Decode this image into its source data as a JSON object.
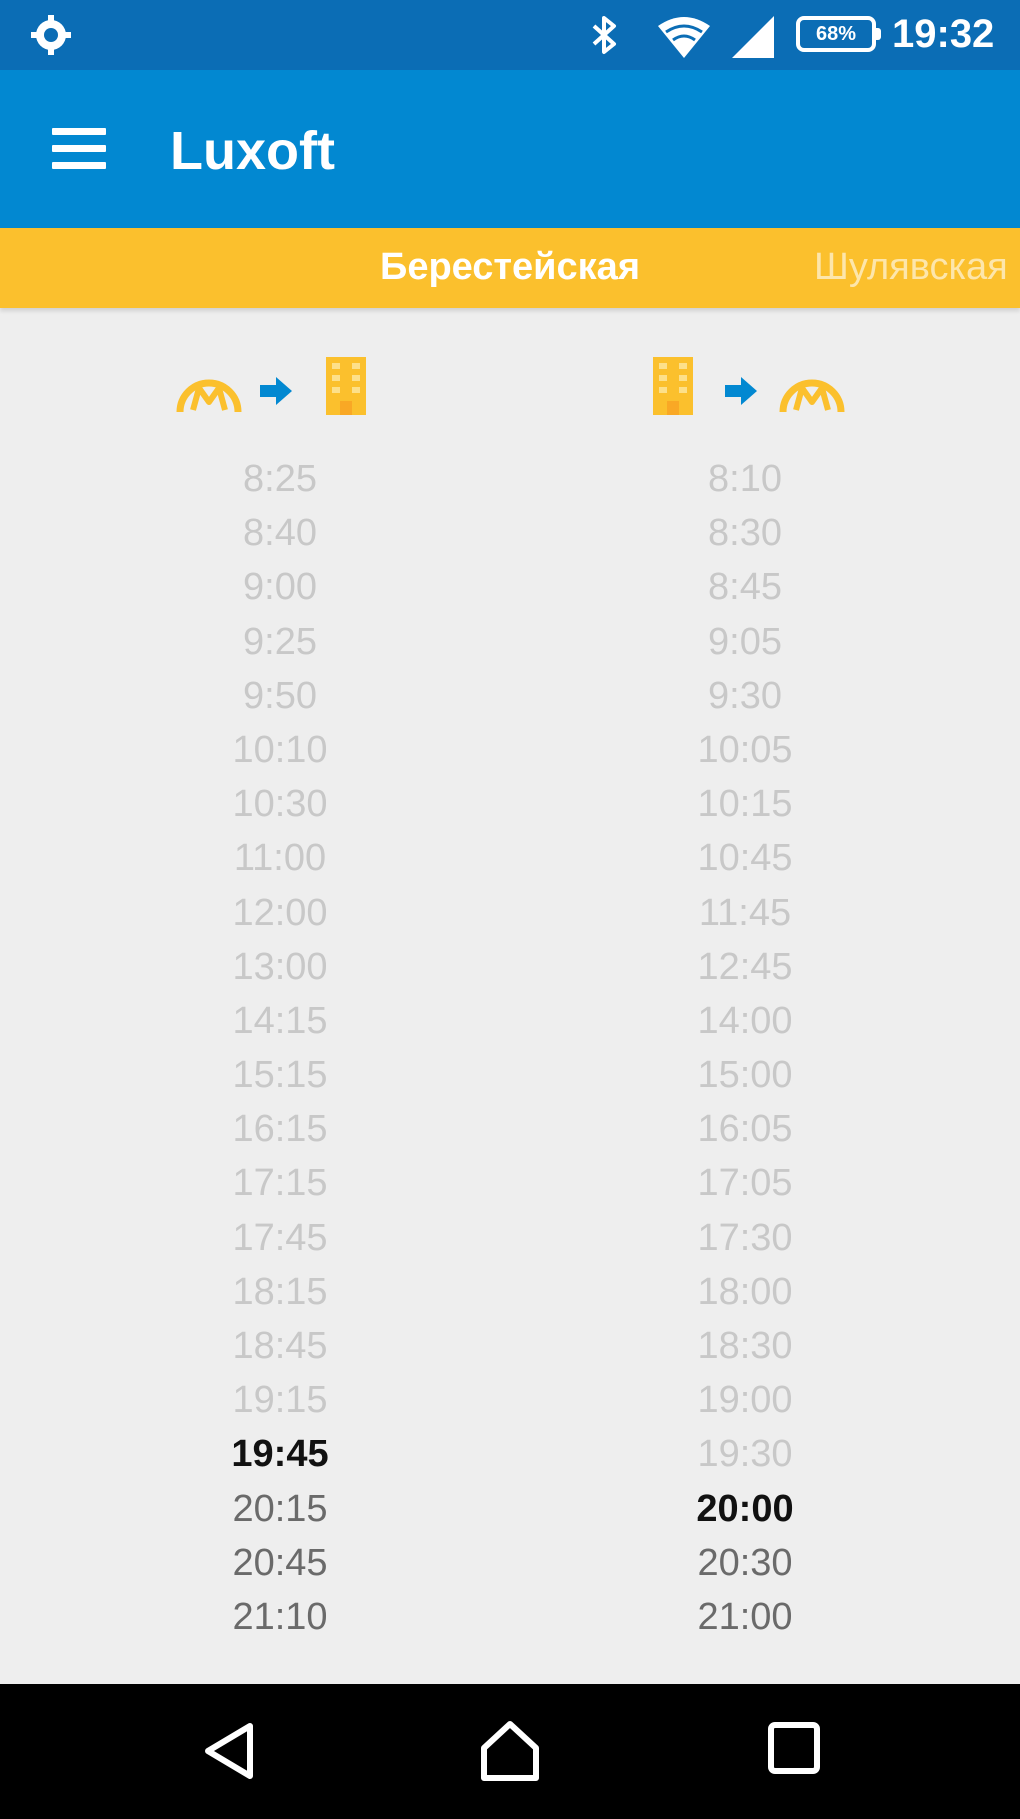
{
  "status_bar": {
    "battery": "68%",
    "time": "19:32",
    "icons": [
      "settings-gear-icon",
      "bluetooth-icon",
      "wifi-icon",
      "signal-icon",
      "battery-icon"
    ]
  },
  "app_bar": {
    "title": "Luxoft",
    "icons": [
      "menu-icon"
    ]
  },
  "tabs": {
    "active": "Берестейская",
    "next": "Шулявская"
  },
  "colors": {
    "status_bar": "#0b6db5",
    "app_bar": "#0288d1",
    "tabs": "#fbc02d",
    "accent_yellow": "#fbc02d",
    "arrow_blue": "#0288d1"
  },
  "columns": [
    {
      "direction_icons": [
        "metro-icon",
        "arrow-right-icon",
        "office-building-icon"
      ],
      "times": [
        "8:25",
        "8:40",
        "9:00",
        "9:25",
        "9:50",
        "10:10",
        "10:30",
        "11:00",
        "12:00",
        "13:00",
        "14:15",
        "15:15",
        "16:15",
        "17:15",
        "17:45",
        "18:15",
        "18:45",
        "19:15",
        "19:45",
        "20:15",
        "20:45",
        "21:10"
      ],
      "current_index": 18
    },
    {
      "direction_icons": [
        "office-building-icon",
        "arrow-right-icon",
        "metro-icon"
      ],
      "times": [
        "8:10",
        "8:30",
        "8:45",
        "9:05",
        "9:30",
        "10:05",
        "10:15",
        "10:45",
        "11:45",
        "12:45",
        "14:00",
        "15:00",
        "16:05",
        "17:05",
        "17:30",
        "18:00",
        "18:30",
        "19:00",
        "19:30",
        "20:00",
        "20:30",
        "21:00"
      ],
      "current_index": 19
    }
  ],
  "nav_bar": {
    "icons": [
      "back-icon",
      "home-icon",
      "recents-icon"
    ]
  }
}
